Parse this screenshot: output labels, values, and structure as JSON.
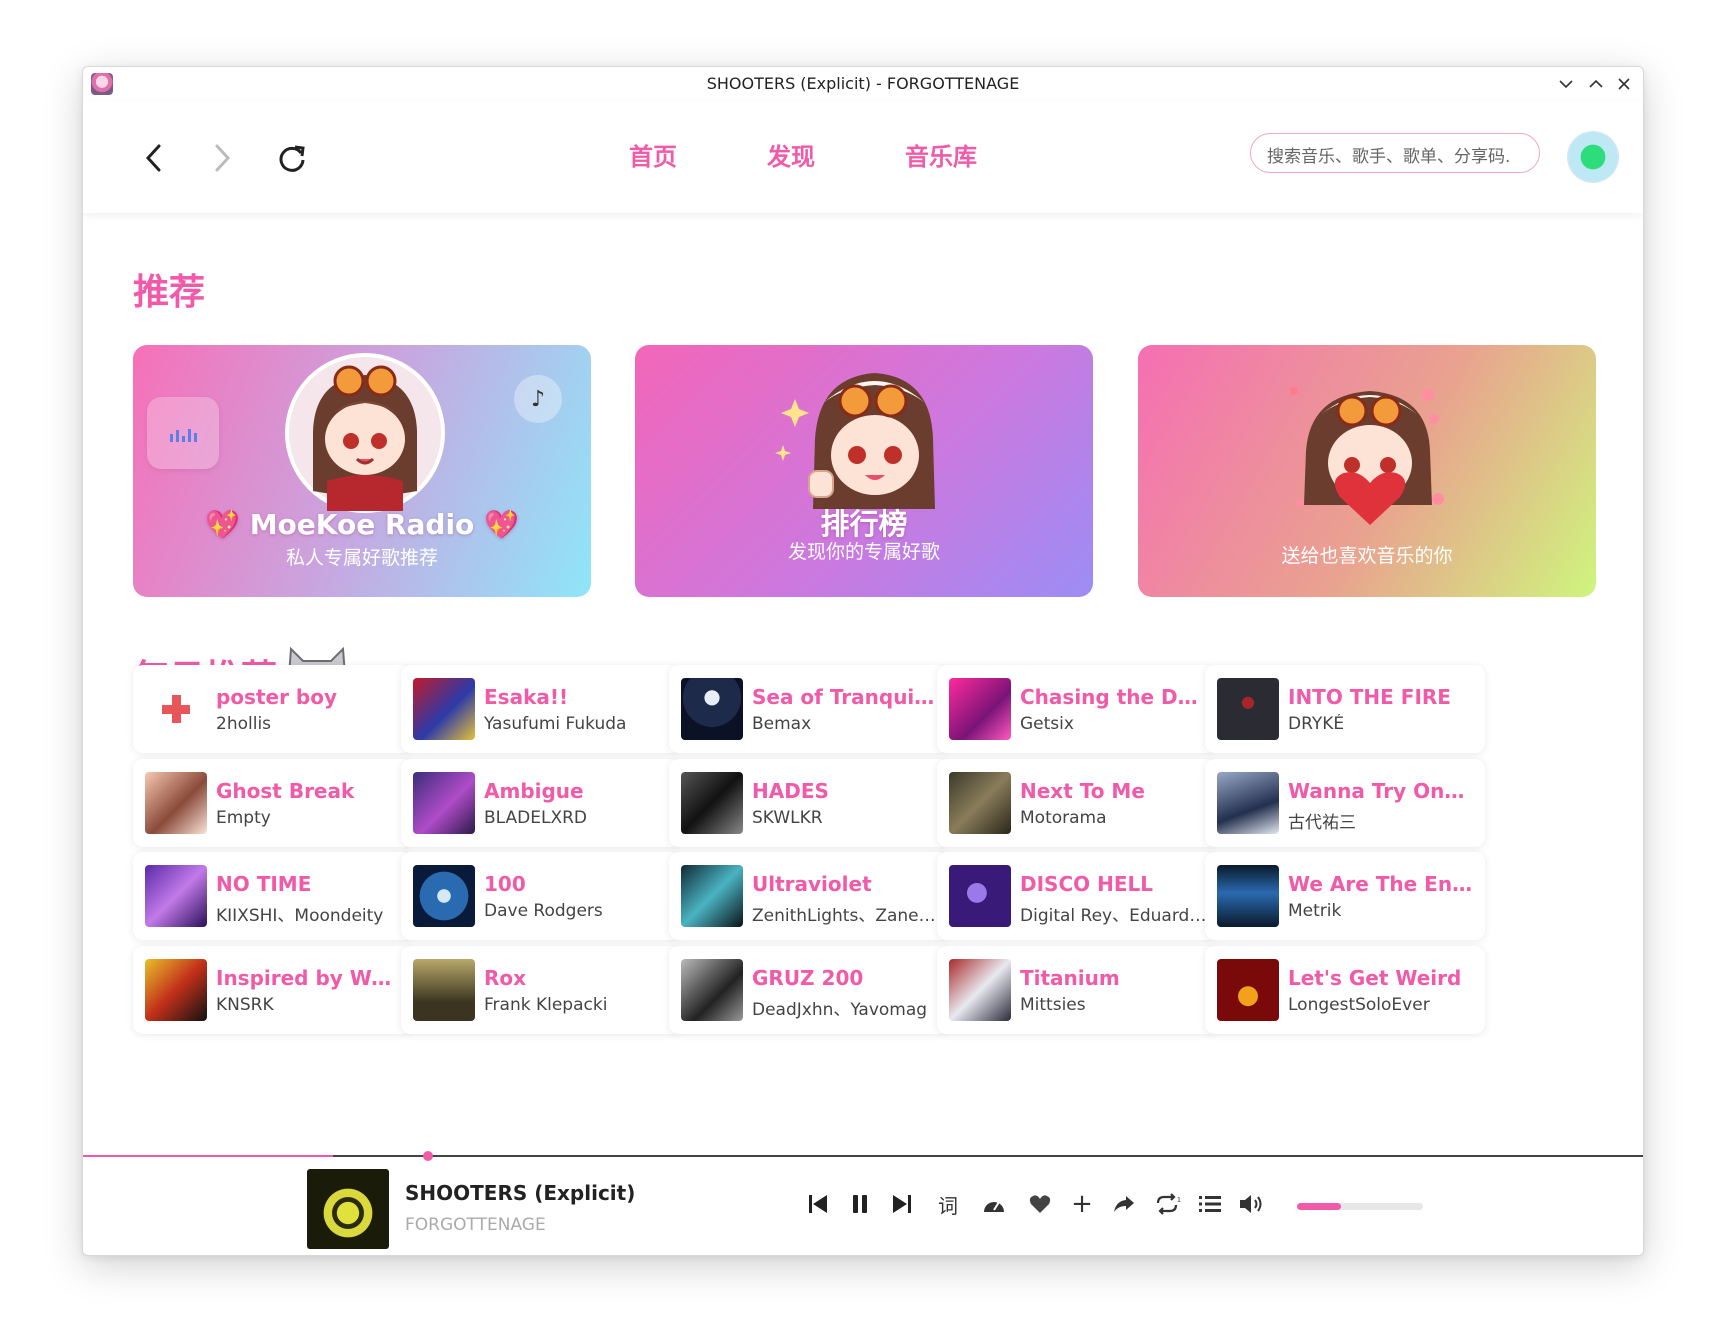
{
  "window": {
    "title": "SHOOTERS (Explicit) - FORGOTTENAGE"
  },
  "nav": {
    "tabs": [
      "首页",
      "发现",
      "音乐库"
    ],
    "search_placeholder": "搜索音乐、歌手、歌单、分享码."
  },
  "sections": {
    "recommend": "推荐",
    "daily": "每日推荐"
  },
  "cards": [
    {
      "title": "MoeKoe Radio",
      "subtitle": "私人专属好歌推荐"
    },
    {
      "title": "排行榜",
      "subtitle": "发现你的专属好歌"
    },
    {
      "title": "",
      "subtitle": "送给也喜欢音乐的你"
    }
  ],
  "songs": [
    {
      "title": "poster boy",
      "artist": "2hollis"
    },
    {
      "title": "Esaka!!",
      "artist": "Yasufumi Fukuda"
    },
    {
      "title": "Sea of Tranquility",
      "artist": "Bemax"
    },
    {
      "title": "Chasing the Drag...",
      "artist": "Getsix"
    },
    {
      "title": "INTO THE FIRE",
      "artist": "DRYKÉ"
    },
    {
      "title": "Ghost Break",
      "artist": "Empty"
    },
    {
      "title": "Ambigue",
      "artist": "BLADELXRD"
    },
    {
      "title": "HADES",
      "artist": "SKWLKR"
    },
    {
      "title": "Next To Me",
      "artist": "Motorama"
    },
    {
      "title": "Wanna Try One L...",
      "artist": "古代祐三"
    },
    {
      "title": "NO TIME",
      "artist": "KIIXSHI、Moondeity"
    },
    {
      "title": "100",
      "artist": "Dave Rodgers"
    },
    {
      "title": "Ultraviolet",
      "artist": "ZenithLights、Zane L..."
    },
    {
      "title": "DISCO HELL",
      "artist": "Digital Rey、Eduard S..."
    },
    {
      "title": "We Are The Energy",
      "artist": "Metrik"
    },
    {
      "title": "Inspired by Wake...",
      "artist": "KNSRK"
    },
    {
      "title": "Rox",
      "artist": "Frank Klepacki"
    },
    {
      "title": "GRUZ 200",
      "artist": "DeadJxhn、Yavomag"
    },
    {
      "title": "Titanium",
      "artist": "Mittsies"
    },
    {
      "title": "Let's Get Weird",
      "artist": "LongestSoloEver"
    }
  ],
  "player": {
    "title": "SHOOTERS (Explicit)",
    "artist": "FORGOTTENAGE",
    "lyrics_label": "词",
    "progress": 0.16,
    "volume": 0.35
  },
  "colors": {
    "accent": "#f05aa8"
  }
}
